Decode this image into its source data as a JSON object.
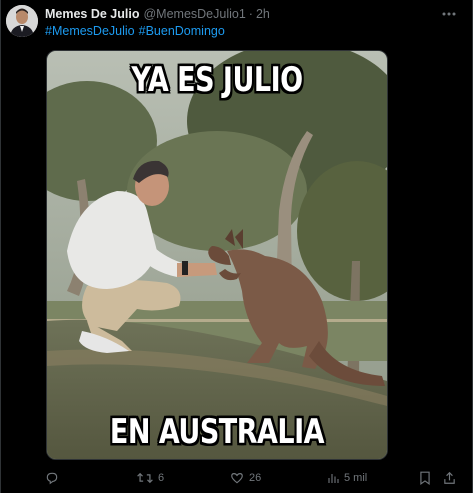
{
  "tweet": {
    "display_name": "Memes De Julio",
    "handle": "@MemesDeJulio1",
    "separator": "·",
    "time": "2h",
    "hashtags": [
      "#MemesDeJulio",
      "#BuenDomingo"
    ]
  },
  "media": {
    "top_caption": "YA ES JULIO",
    "bottom_caption": "EN AUSTRALIA"
  },
  "actions": {
    "reply": {
      "icon": "reply-icon",
      "count": ""
    },
    "retweet": {
      "icon": "retweet-icon",
      "count": "6"
    },
    "like": {
      "icon": "heart-icon",
      "count": "26"
    },
    "views": {
      "icon": "views-icon",
      "count": "5 mil"
    },
    "bookmark": {
      "icon": "bookmark-icon"
    },
    "share": {
      "icon": "share-icon"
    }
  },
  "colors": {
    "background": "#000000",
    "link": "#1d9bf0",
    "muted": "#71767b",
    "text": "#e7e9ea"
  }
}
